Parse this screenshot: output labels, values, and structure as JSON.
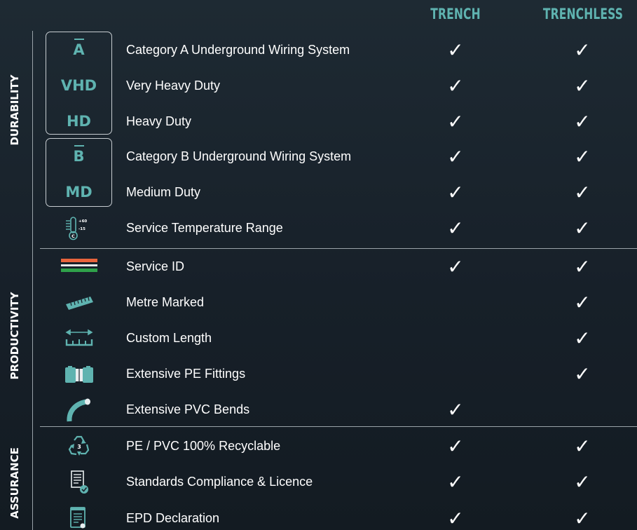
{
  "columns": {
    "trench": "TRENCH",
    "trenchless": "TRENCHLESS"
  },
  "sections": {
    "durability": "DURABILITY",
    "productivity": "PRODUCTIVITY",
    "assurance": "ASSURANCE"
  },
  "check_glyph": "✓",
  "accent_color": "#5fb3b0",
  "rows": [
    {
      "code": "A",
      "code_bar": true,
      "label": "Category A Underground Wiring System",
      "trench": true,
      "trenchless": true
    },
    {
      "code": "VHD",
      "label": "Very Heavy Duty",
      "trench": true,
      "trenchless": true
    },
    {
      "code": "HD",
      "label": "Heavy Duty",
      "trench": true,
      "trenchless": true
    },
    {
      "code": "B",
      "code_bar": true,
      "label": "Category B Underground Wiring System",
      "trench": true,
      "trenchless": true
    },
    {
      "code": "MD",
      "label": "Medium Duty",
      "trench": true,
      "trenchless": true
    },
    {
      "icon": "thermometer-icon",
      "icon_text": {
        "hi": "+60",
        "lo": "-15",
        "unit": "C"
      },
      "label": "Service Temperature Range",
      "trench": true,
      "trenchless": true
    },
    {
      "icon": "service-id-stripes-icon",
      "label": "Service ID",
      "trench": true,
      "trenchless": true
    },
    {
      "icon": "ruler-icon",
      "label": "Metre Marked",
      "trench": false,
      "trenchless": true
    },
    {
      "icon": "custom-length-icon",
      "label": "Custom Length",
      "trench": false,
      "trenchless": true
    },
    {
      "icon": "pe-fitting-icon",
      "label": "Extensive PE Fittings",
      "trench": false,
      "trenchless": true
    },
    {
      "icon": "pvc-bend-icon",
      "label": "Extensive PVC Bends",
      "trench": true,
      "trenchless": false
    },
    {
      "icon": "recycle-icon",
      "icon_text": {
        "num": "3"
      },
      "label": "PE / PVC 100% Recyclable",
      "trench": true,
      "trenchless": true
    },
    {
      "icon": "certificate-document-icon",
      "label": "Standards Compliance & Licence",
      "trench": true,
      "trenchless": true
    },
    {
      "icon": "epd-document-icon",
      "label": "EPD Declaration",
      "trench": true,
      "trenchless": true
    }
  ]
}
